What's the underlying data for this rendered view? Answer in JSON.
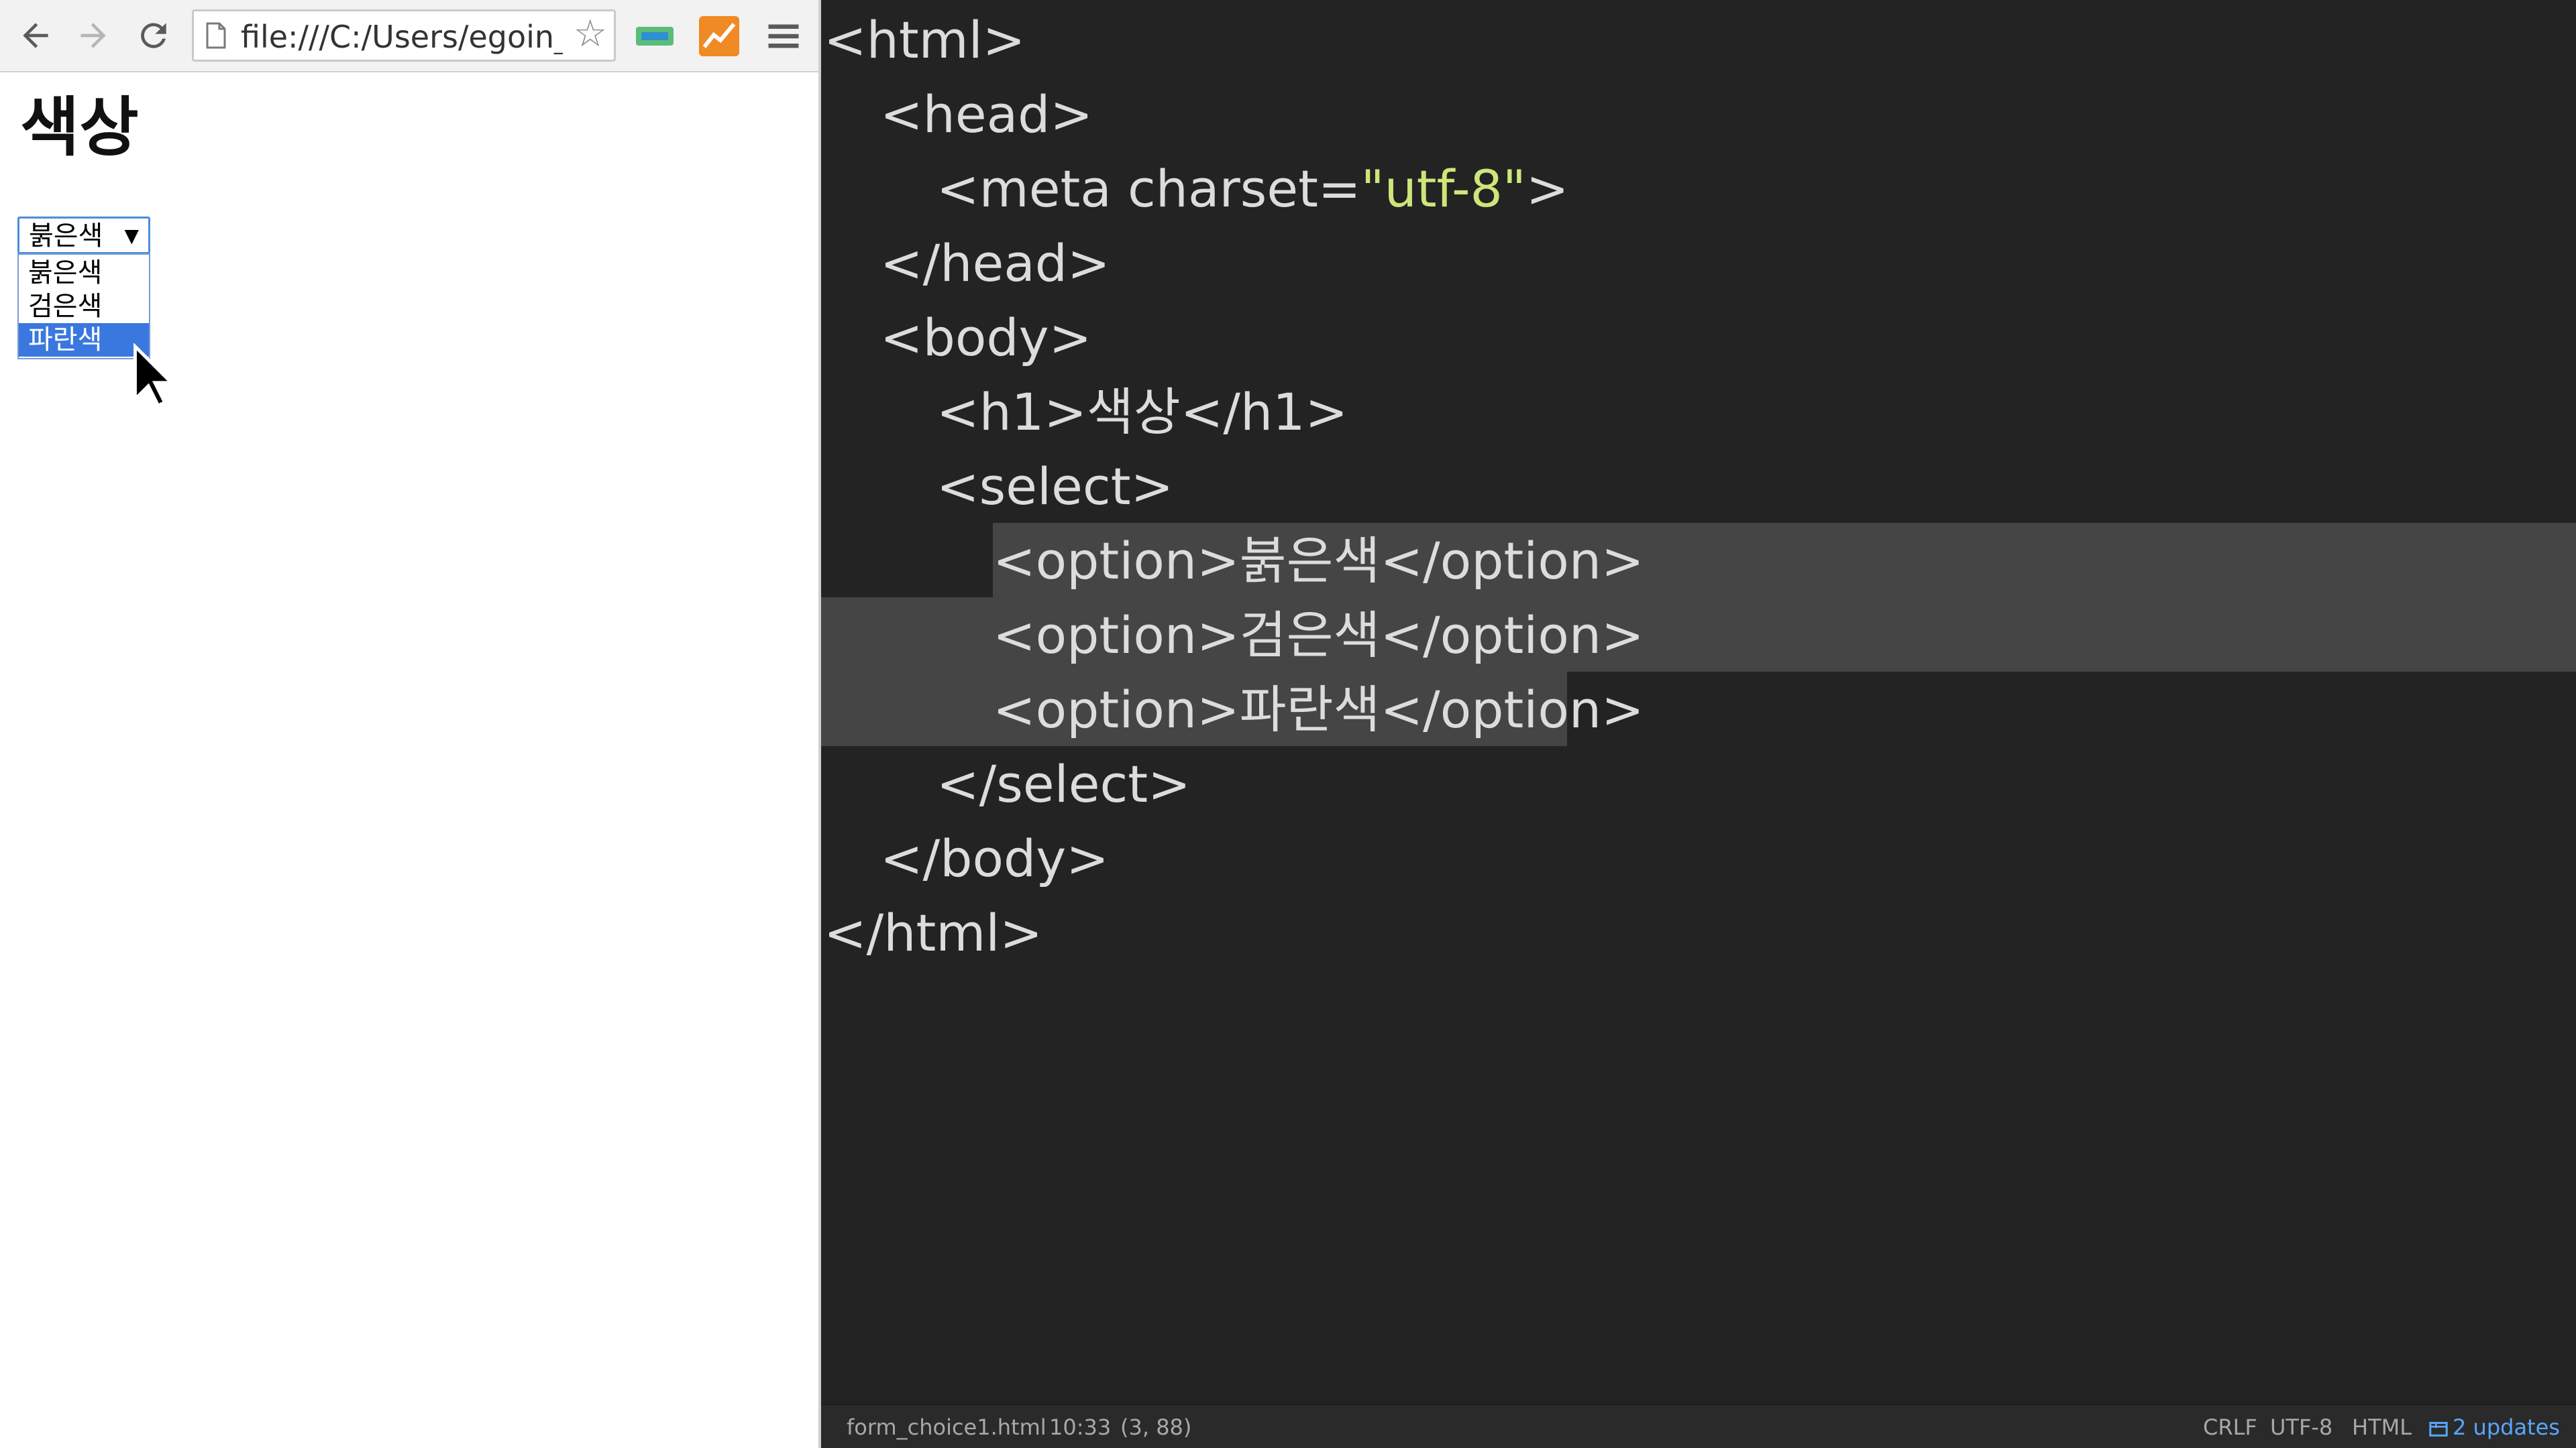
{
  "browser": {
    "url": "file:///C:/Users/egoin_(",
    "icons": [
      "back-arrow-icon",
      "forward-arrow-icon",
      "reload-icon",
      "page-icon",
      "star-icon",
      "extension-icon",
      "chart-extension-icon",
      "menu-icon"
    ],
    "page": {
      "heading": "색상",
      "select": {
        "selected": "붉은색",
        "options": [
          "붉은색",
          "검은색",
          "파란색"
        ],
        "highlighted_index": 2
      }
    }
  },
  "editor": {
    "code_lines": [
      "<html>",
      "<head>",
      "<meta charset=",
      "\"utf-8\"",
      ">",
      "</head>",
      "<body>",
      "<h1>색상</h1>",
      "<select>",
      "<option>붉은색</option>",
      "<option>검은색</option>",
      "<option>파란색</option>",
      "</select>",
      "</body>",
      "</html>"
    ],
    "colors": {
      "background": "#232323",
      "text": "#dcdcdc",
      "string": "#cde67a",
      "selection": "#454545"
    }
  },
  "statusbar": {
    "filename": "form_choice1.html",
    "cursor": "10:33",
    "selection": "(3, 88)",
    "line_ending": "CRLF",
    "encoding": "UTF-8",
    "grammar": "HTML",
    "updates": "2 updates"
  }
}
